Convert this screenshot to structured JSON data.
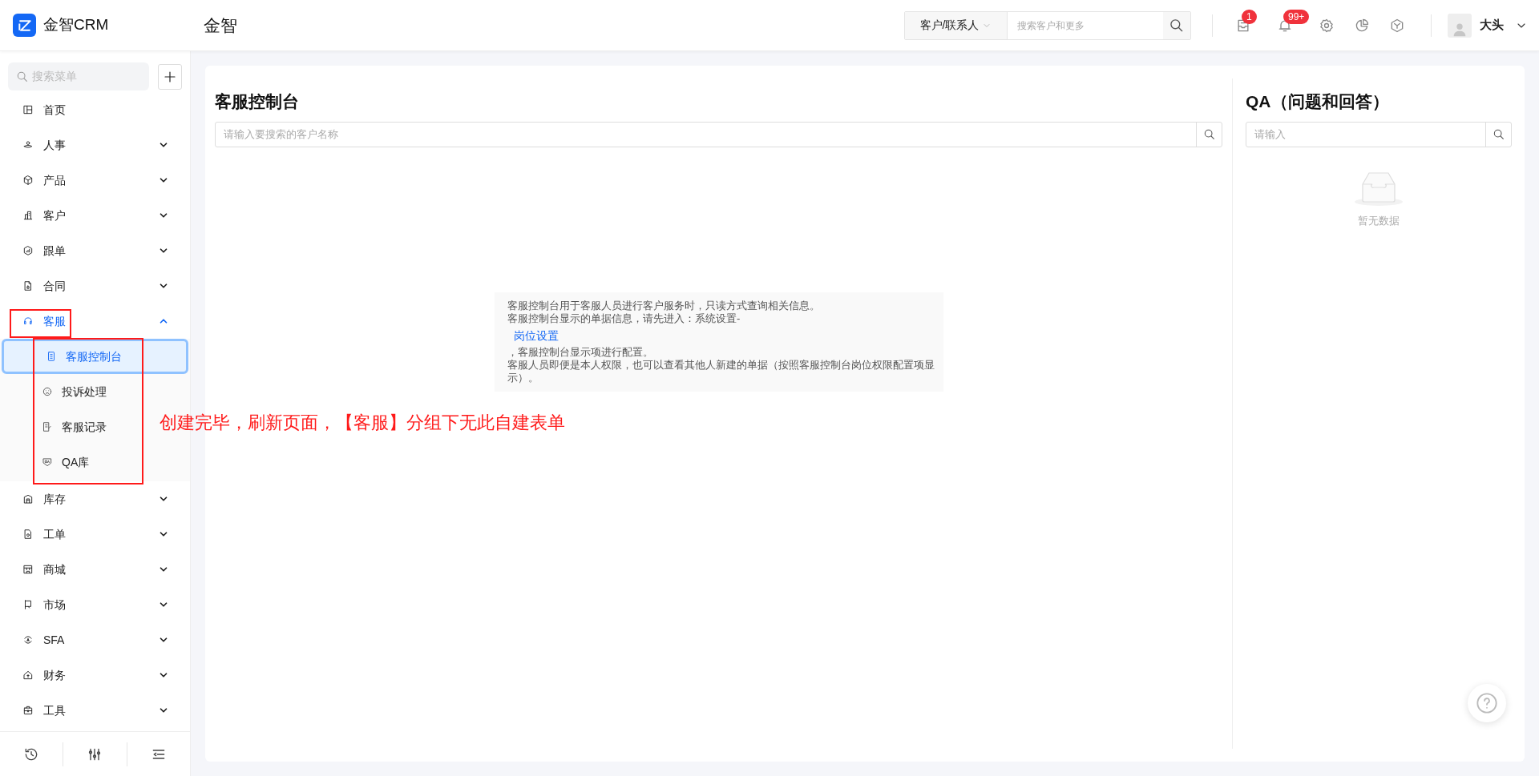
{
  "header": {
    "logo_text": "金智CRM",
    "company": "金智",
    "search": {
      "scope": "客户/联系人",
      "placeholder": "搜索客户和更多"
    },
    "notifications": [
      {
        "badge": "1"
      },
      {
        "badge": "99+"
      }
    ],
    "user": "大头"
  },
  "sidebar": {
    "search_placeholder": "搜索菜单",
    "items": [
      {
        "kind": "link",
        "label": "首页",
        "selected": false
      },
      {
        "kind": "group",
        "label": "人事",
        "expanded": false,
        "selected": false
      },
      {
        "kind": "group",
        "label": "产品",
        "expanded": false,
        "selected": false
      },
      {
        "kind": "group",
        "label": "客户",
        "expanded": false,
        "selected": false
      },
      {
        "kind": "group",
        "label": "跟单",
        "expanded": false,
        "selected": false
      },
      {
        "kind": "group",
        "label": "合同",
        "expanded": false,
        "selected": false
      },
      {
        "kind": "group",
        "label": "客服",
        "expanded": true,
        "selected": true,
        "children": [
          {
            "label": "客服控制台",
            "selected": true
          },
          {
            "label": "投诉处理",
            "selected": false
          },
          {
            "label": "客服记录",
            "selected": false
          },
          {
            "label": "QA库",
            "selected": false
          }
        ]
      },
      {
        "kind": "group",
        "label": "库存",
        "expanded": false,
        "selected": false
      },
      {
        "kind": "group",
        "label": "工单",
        "expanded": false,
        "selected": false
      },
      {
        "kind": "group",
        "label": "商城",
        "expanded": false,
        "selected": false
      },
      {
        "kind": "group",
        "label": "市场",
        "expanded": false,
        "selected": false
      },
      {
        "kind": "group",
        "label": "SFA",
        "expanded": false,
        "selected": false
      },
      {
        "kind": "group",
        "label": "财务",
        "expanded": false,
        "selected": false
      },
      {
        "kind": "group",
        "label": "工具",
        "expanded": false,
        "selected": false
      }
    ]
  },
  "console": {
    "title": "客服控制台",
    "search_placeholder": "请输入要搜索的客户名称",
    "info": {
      "line1": "客服控制台用于客服人员进行客户服务时，只读方式查询相关信息。",
      "line2": "客服控制台显示的单据信息，请先进入：系统设置-",
      "link": "岗位设置",
      "line3": "，客服控制台显示项进行配置。",
      "line4": "客服人员即便是本人权限，也可以查看其他人新建的单据（按照客服控制台岗位权限配置项显示）。"
    }
  },
  "qa": {
    "title": "QA（问题和回答）",
    "search_placeholder": "请输入",
    "empty_text": "暂无数据"
  },
  "annotation": {
    "text": "创建完毕，刷新页面，【客服】分组下无此自建表单"
  }
}
